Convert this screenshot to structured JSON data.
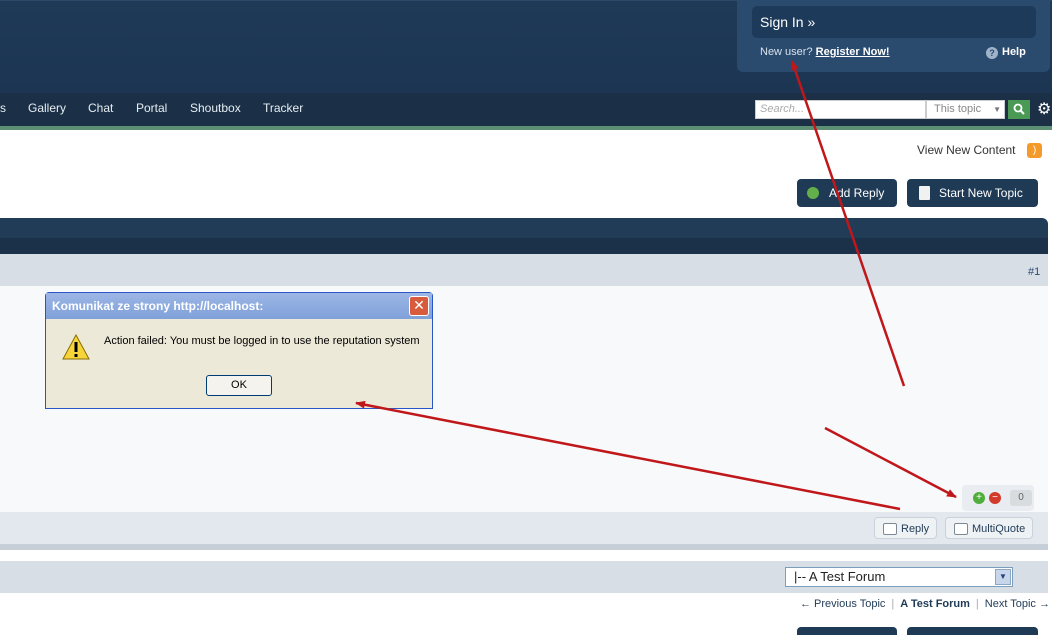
{
  "header": {
    "sign_in": "Sign In »",
    "new_user": "New user?",
    "register": "Register Now!",
    "help": "Help"
  },
  "nav": {
    "items": [
      "s",
      "Gallery",
      "Chat",
      "Portal",
      "Shoutbox",
      "Tracker"
    ],
    "search_placeholder": "Search...",
    "search_scope": "This topic"
  },
  "content": {
    "view_new": "View New Content",
    "add_reply": "Add Reply",
    "start_new_topic": "Start New Topic"
  },
  "post": {
    "number": "#1",
    "rep_count": "0",
    "reply": "Reply",
    "multiquote": "MultiQuote"
  },
  "footer": {
    "forum_select": "|-- A Test Forum",
    "prev_topic": "← Previous Topic",
    "forum_link": "A Test Forum",
    "next_topic": "Next Topic →"
  },
  "dialog": {
    "title": "Komunikat ze strony http://localhost:",
    "message": "Action failed: You must be logged in to use the reputation system",
    "ok": "OK"
  },
  "colors": {
    "header_bg": "#1f3a57",
    "nav_bg": "#1b3046",
    "accent_green": "#5d8f74",
    "annotation_arrow": "#c0171b"
  }
}
